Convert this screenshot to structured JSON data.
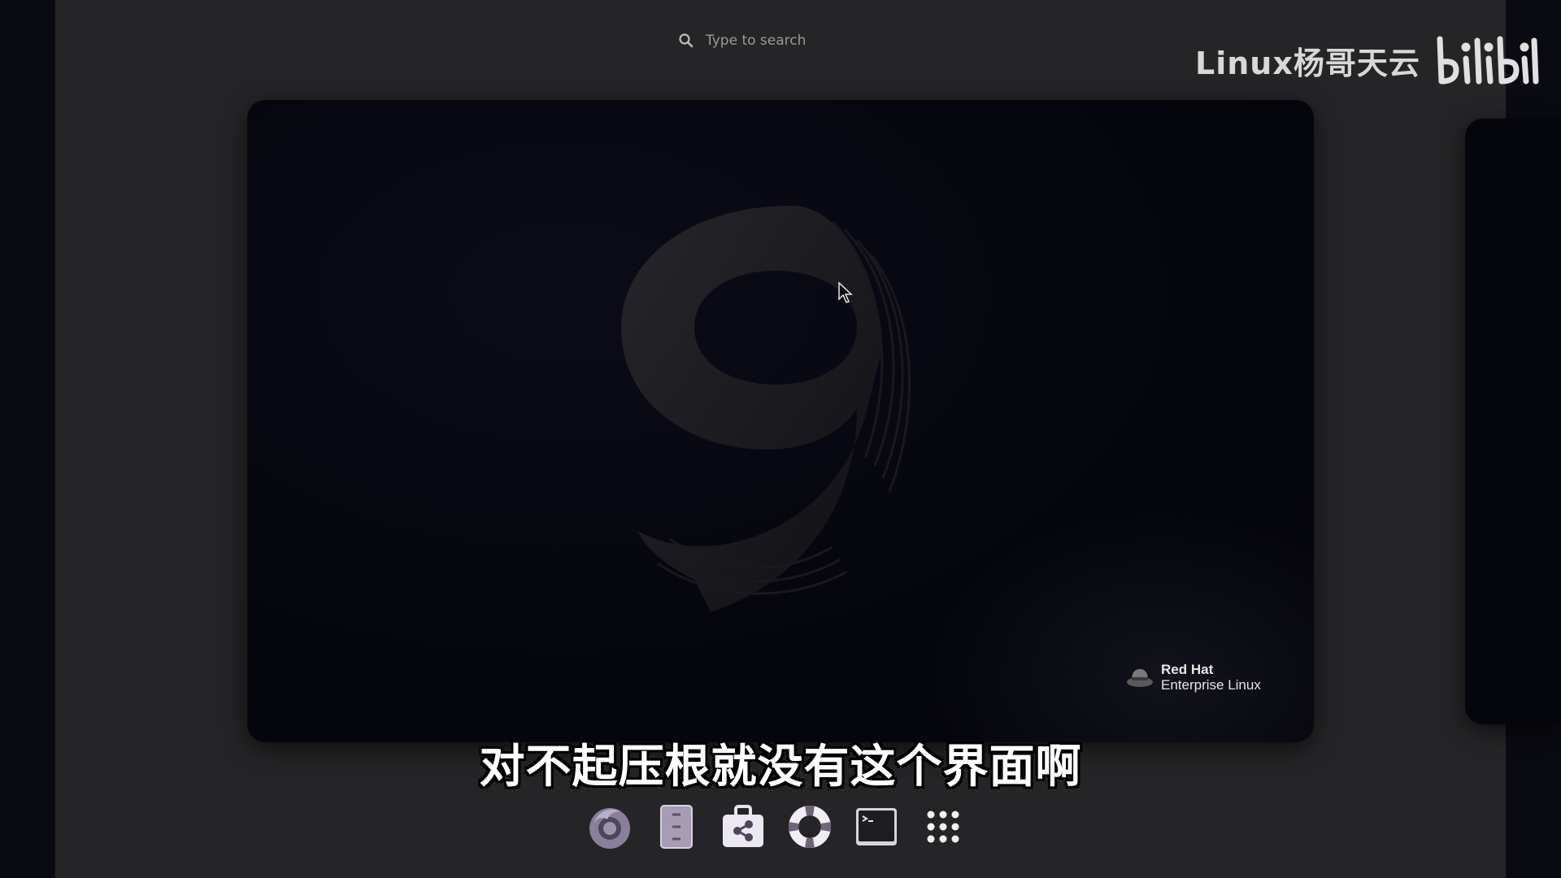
{
  "search": {
    "placeholder": "Type to search",
    "icon": "search-icon"
  },
  "watermark": {
    "text": "Linux杨哥天云",
    "logo": "bilibili"
  },
  "workspace": {
    "wallpaper_number": "9",
    "brand": {
      "line1": "Red Hat",
      "line2": "Enterprise Linux"
    }
  },
  "subtitle": "对不起压根就没有这个界面啊",
  "dash": {
    "items": [
      {
        "name": "firefox-icon"
      },
      {
        "name": "files-icon"
      },
      {
        "name": "software-icon"
      },
      {
        "name": "help-icon"
      },
      {
        "name": "terminal-icon"
      },
      {
        "name": "app-grid-icon"
      }
    ]
  }
}
